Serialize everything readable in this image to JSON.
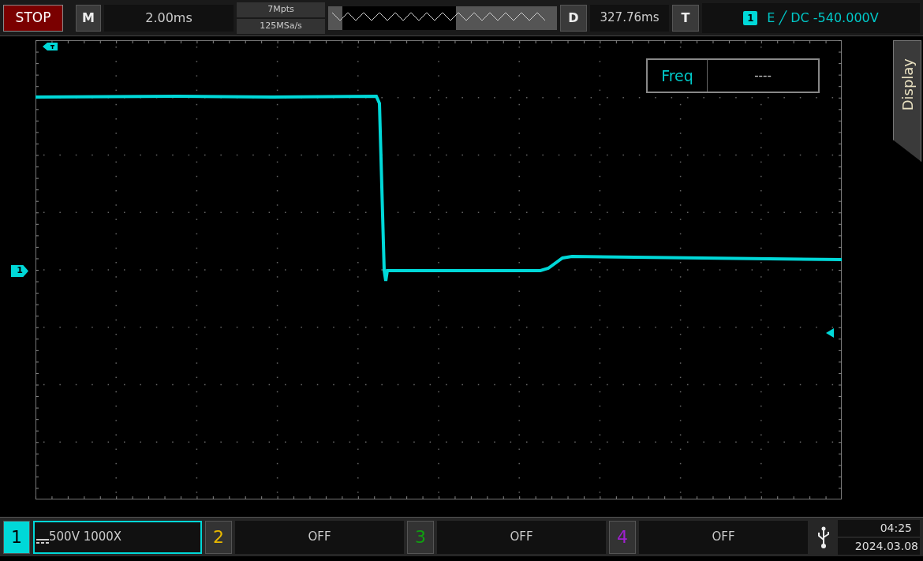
{
  "top_bar": {
    "run_state": {
      "label": "STOP",
      "running": false
    },
    "mode_button": "M",
    "timebase": "2.00ms",
    "memory_depth": "7Mpts",
    "sample_rate": "125MSa/s",
    "delay_button": "D",
    "delay": "327.76ms",
    "trigger_button": "T",
    "trigger": {
      "source": "1",
      "setting": "E ╱ DC -540.000V"
    }
  },
  "screen": {
    "channel_marker": "1",
    "measurement": {
      "label": "Freq",
      "value": "----"
    },
    "side_tab": "Display"
  },
  "channels": [
    {
      "number": "1",
      "color": "#00d8d8",
      "active": true,
      "dc_coupled": true,
      "setting": "500V 1000X"
    },
    {
      "number": "2",
      "color": "#e8b800",
      "active": false,
      "dc_coupled": false,
      "setting": "OFF"
    },
    {
      "number": "3",
      "color": "#10a010",
      "active": false,
      "dc_coupled": false,
      "setting": "OFF"
    },
    {
      "number": "4",
      "color": "#a020d0",
      "active": false,
      "dc_coupled": false,
      "setting": "OFF"
    }
  ],
  "clock": {
    "time": "04:25",
    "date": "2024.03.08"
  }
}
